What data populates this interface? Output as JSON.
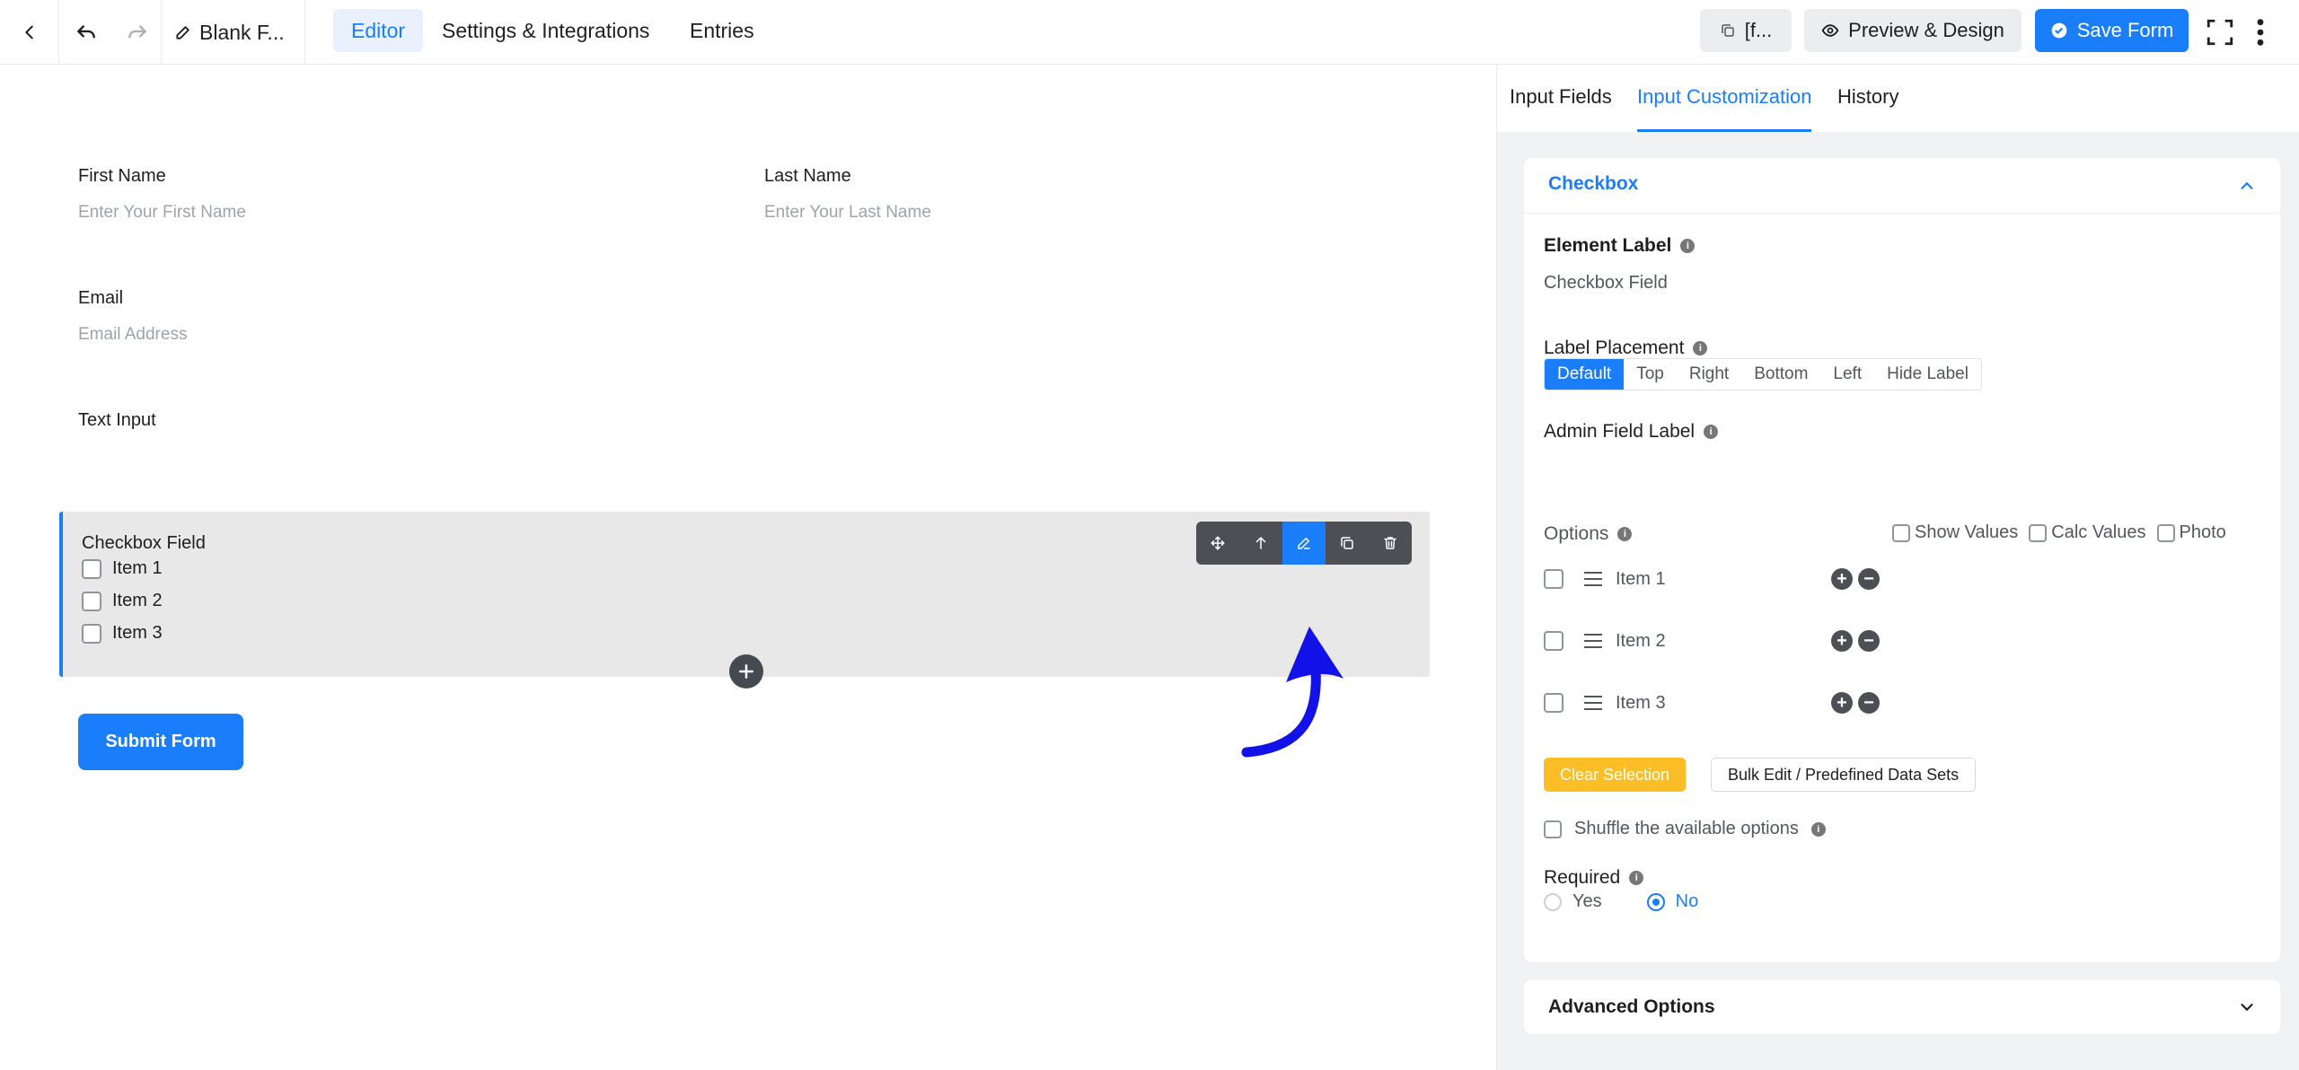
{
  "topbar": {
    "form_title": "Blank F...",
    "tabs": [
      {
        "label": "Editor",
        "active": true
      },
      {
        "label": "Settings & Integrations",
        "active": false
      },
      {
        "label": "Entries",
        "active": false
      }
    ],
    "shortcode_label": "[f...",
    "preview_label": "Preview & Design",
    "save_label": "Save Form"
  },
  "form": {
    "first_name_label": "First Name",
    "first_name_placeholder": "Enter Your First Name",
    "last_name_label": "Last Name",
    "last_name_placeholder": "Enter Your Last Name",
    "email_label": "Email",
    "email_placeholder": "Email Address",
    "text_input_label": "Text Input",
    "checkbox_label": "Checkbox Field",
    "checkbox_items": [
      "Item 1",
      "Item 2",
      "Item 3"
    ],
    "submit_label": "Submit Form"
  },
  "panel": {
    "tabs": [
      {
        "label": "Input Fields",
        "active": false
      },
      {
        "label": "Input Customization",
        "active": true
      },
      {
        "label": "History",
        "active": false
      }
    ],
    "section_title": "Checkbox",
    "element_label_title": "Element Label",
    "element_label_value": "Checkbox Field",
    "label_placement_title": "Label Placement",
    "placement_options": [
      "Default",
      "Top",
      "Right",
      "Bottom",
      "Left",
      "Hide Label"
    ],
    "placement_selected": "Default",
    "admin_label_title": "Admin Field Label",
    "options_title": "Options",
    "show_values": "Show Values",
    "calc_values": "Calc Values",
    "photo": "Photo",
    "option_items": [
      "Item 1",
      "Item 2",
      "Item 3"
    ],
    "clear_selection": "Clear Selection",
    "bulk_edit": "Bulk Edit / Predefined Data Sets",
    "shuffle_label": "Shuffle the available options",
    "required_title": "Required",
    "required_yes": "Yes",
    "required_no": "No",
    "required_selected": "No",
    "advanced_title": "Advanced Options"
  },
  "colors": {
    "accent": "#1a7efb",
    "warning": "#fbbe27",
    "annotation_arrow": "#1212e8"
  }
}
